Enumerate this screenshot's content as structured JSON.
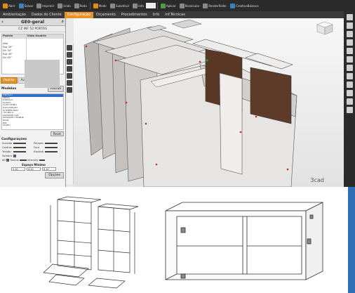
{
  "toolbar": {
    "items": [
      "Abrir",
      "Salvar",
      "Imprimir",
      "Undo",
      "Redo",
      "Medir",
      "Substituir",
      "Info",
      "Aplicar",
      "Recalcular",
      "RenderRoller",
      "CreativeBalance"
    ],
    "field_value": "",
    "accent": "#e6922b"
  },
  "menu": {
    "tabs": [
      "Ambientação",
      "Dados do Cliente",
      "Configuração",
      "Orçamento",
      "Procedimentos",
      "Info",
      "inf.Técnicas"
    ],
    "active": "Configuração"
  },
  "panel": {
    "title": "GE0-geral",
    "subtitle": "CZ INF 52 PORTAS",
    "grid_headers": [
      "Padrão",
      "Vista Usuário"
    ],
    "grid_rows": [
      [
        "",
        ""
      ],
      [
        "Alto",
        ""
      ],
      [
        "Esq 30°",
        ""
      ],
      [
        "Dir 30°",
        ""
      ],
      [
        "Esq 45°",
        ""
      ],
      [
        "Dir 45°",
        ""
      ]
    ],
    "subtabs": [
      "Padrão",
      "Avançado",
      "Render"
    ],
    "active_subtab": "Padrão",
    "models_label": "Modelos",
    "padrao_button": "Padrão",
    "model_items": [
      "FRESCO",
      "PAPEL",
      "ESBOÇO",
      "EDGES",
      "CONTORNO",
      "ILUSTRAÇÃO",
      "SOMBREADO",
      "TÉCNICO",
      "DESENHO DE",
      "DESENHO HANDE",
      "REAL",
      "",
      "BW",
      "VIDRO",
      "GRAY"
    ],
    "selected_model_index": 0,
    "reset_button": "Reset",
    "config_label": "Configurações",
    "config_rows": [
      [
        "Suavidad",
        "Perspectiva"
      ],
      [
        "Contraste",
        "Foco"
      ],
      [
        "Tensão Contorno",
        "Expósito"
      ],
      [
        "Sombra",
        ""
      ]
    ],
    "aa_label": "AO",
    "radius_label": "Radius",
    "intensity_label": "Intensity",
    "espaco_title": "Espaço Mínimo",
    "espaco_values": [
      "3.10",
      "4.10",
      "4.10"
    ],
    "opcoes_button": "Opções"
  },
  "viewport": {
    "brand": "3cad"
  }
}
